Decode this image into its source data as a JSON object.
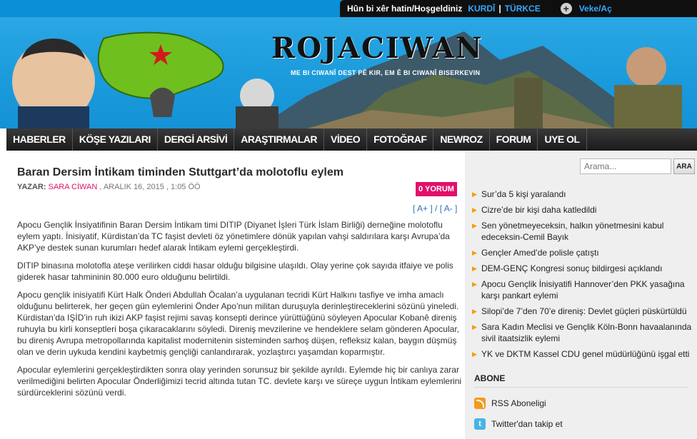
{
  "topbar": {
    "welcome": "Hûn bi xêr hatin/Hoşgeldiniz",
    "lang_kurdi": "KURDÎ",
    "lang_sep": "|",
    "lang_turkce": "TÜRKCE",
    "plus_glyph": "+",
    "login": "Veke/Aç"
  },
  "header": {
    "logo": "ROJACIWAN",
    "slogan": "ME BI CIWANÎ DEST PÊ KIR, EM Ê BI CIWANÎ BISERKEVIN"
  },
  "nav": {
    "items": [
      "HABERLER",
      "KÖŞE YAZILARI",
      "DERGİ ARSİVİ",
      "ARAŞTIRMALAR",
      "VİDEO",
      "FOTOĞRAF",
      "NEWROZ",
      "FORUM",
      "UYE OL"
    ]
  },
  "article": {
    "title": "Baran Dersim İntikam timinden Stuttgart’da molotoflu eylem",
    "author_prefix": "YAZAR:",
    "author": "SARA CİWAN",
    "date": ", ARALIK 16, 2015 , 1:05 ÖÖ",
    "comments": "0 YORUM",
    "font_increase": "[ A+ ]",
    "font_sep": "/",
    "font_decrease": "[ A- ]",
    "paragraphs": [
      "Apocu Gençlik İnsiyatifinin Baran Dersim İntikam timi DITIP (Diyanet İşleri Türk İslam Birliği) derneğine molotoflu eylem yaptı. İnisiyatif, Kürdistan’da TC faşist devleti öz yönetimlere dönük yapılan vahşi saldırılara karşı Avrupa’da AKP’ye destek sunan kurumları hedef alarak İntikam eylemi gerçekleştirdi.",
      "DITIP binasına molotofla ateşe verilirken ciddi hasar olduğu bilgisine ulaşıldı. Olay yerine çok sayıda itfaiye ve polis giderek hasar tahmininin 80.000 euro olduğunu belirtildi.",
      "Apocu gençlik inisiyatifi Kürt Halk Önderi Abdullah Öcalan’a uygulanan tecridi Kürt Halkını tasfiye ve imha amaclı olduğunu belirterek, her geçen gün eylemlerini Önder Apo’nun militan duruşuyla derinleştireceklerini sözünü yineledi. Kürdistan’da IŞİD’in ruh ikizi AKP faşist rejimi savaş konsepti derince yürüttüğünü söyleyen Apocular Kobanê direniş ruhuyla bu kirli konseptleri boşa çıkaracaklarını söyledi. Direniş mevzilerine ve hendeklere selam gönderen Apocular, bu direniş Avrupa metropollarında kapitalist modernitenin sisteminden sarhoş düşen, refleksiz kalan, baygın düşmüş olan ve derin uykuda kendini kaybetmiş gençliği canlandırarak, yozlaştırcı yaşamdan koparmıştır.",
      "Apocular eylemlerini gerçekleştirdikten sonra olay yerinden sorunsuz bir şekilde ayrıldı. Eylemde hiç bir canlıya zarar verilmediğini belirten Apocular Önderliğimizi tecrid altında tutan TC. devlete karşı ve süreçe uygun İntikam eylemlerini sürdürceklerini sözünü verdi."
    ]
  },
  "sidebar": {
    "search_placeholder": "Arama...",
    "search_button": "ARA",
    "bullet_glyph": "▶",
    "news": [
      "Sur’da 5 kişi yaralandı",
      "Cizre’de bir kişi daha katledildi",
      "Sen yönetmeyeceksin, halkın yönetmesini kabul edeceksin-Cemil Bayık",
      "Gençler Amed’de polisle çatıştı",
      "DEM-GENÇ Kongresi sonuç bildirgesi açıklandı",
      "Apocu Gençlik İnisiyatifi Hannover’den PKK yasağına karşı pankart eylemi",
      "Silopi’de 7’den 70’e direniş: Devlet güçleri püskürtüldü",
      "Sara Kadın Meclisi ve Gençlik Köln-Bonn havaalanında sivil itaatsizlik eylemi",
      "YK ve DKTM Kassel CDU genel müdürlüğünü işgal etti"
    ],
    "subscribe_title": "ABONE",
    "rss_label": "RSS Aboneligi",
    "twitter_label": "Twitter'dan takip et",
    "twitter_glyph": "t"
  },
  "colors": {
    "accent_pink": "#e0106b",
    "link_blue": "#2b6fb8",
    "header_blue": "#1a9adb",
    "nav_dark": "#1b1b1b"
  }
}
